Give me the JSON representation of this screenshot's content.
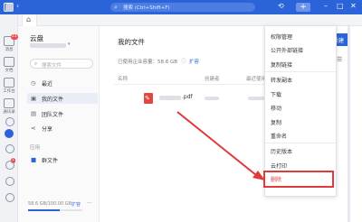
{
  "topbar": {
    "search_placeholder": "搜索 (Ctrl+Shift+F)",
    "plus_label": "+",
    "min_label": "–",
    "max_label": "□",
    "close_label": "✕",
    "back_label": "‹",
    "history_label": "⟲"
  },
  "rail": {
    "items": [
      {
        "label": "消息",
        "badge": "21",
        "icon": "chat-icon"
      },
      {
        "label": "文档",
        "icon": "document-icon"
      },
      {
        "label": "工作台",
        "icon": "workbench-icon"
      },
      {
        "label": "通讯录",
        "icon": "contacts-icon"
      }
    ],
    "extra_badge": "1"
  },
  "sidebar": {
    "title": "云盘",
    "search_placeholder": "搜索文件",
    "items": [
      {
        "label": "最近",
        "icon": "clock-icon"
      },
      {
        "label": "我的文件",
        "icon": "folder-icon"
      },
      {
        "label": "团队文件",
        "icon": "team-folder-icon"
      },
      {
        "label": "分享",
        "icon": "share-icon"
      }
    ],
    "group_label": "应用",
    "app_item": {
      "label": "群文件",
      "icon": "group-file-icon"
    },
    "quota_text": "58.6 GB/100.00 GB",
    "quota_fraction": 0.586,
    "expand_label": "扩容",
    "more_label": "···"
  },
  "main": {
    "title": "我的文件",
    "new_button": "新建",
    "quota_text": "已使用企业容量：58.6 GB",
    "expand_label": "扩容",
    "columns": [
      "名称",
      "创建者",
      "最近使用"
    ],
    "file": {
      "ext": ".pdf",
      "icon": "pdf-icon"
    }
  },
  "menu": {
    "items": [
      "权限管理",
      "公开外部链接",
      "复制链接",
      "转发副本",
      "下载",
      "移动",
      "复制",
      "重命名",
      "历史版本",
      "云打印",
      "删除"
    ]
  },
  "colors": {
    "brand": "#2b64d9",
    "danger": "#e03b3b",
    "pdf": "#e2463f"
  }
}
